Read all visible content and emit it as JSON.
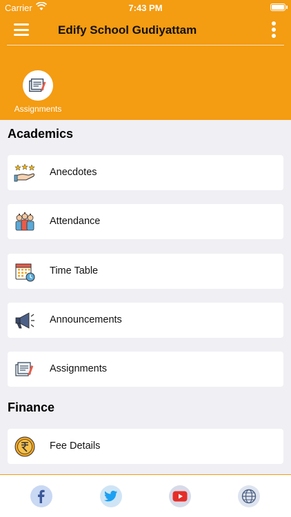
{
  "status_bar": {
    "carrier": "Carrier",
    "time": "7:43 PM"
  },
  "header": {
    "title": "Edify School Gudiyattam"
  },
  "quick_access": {
    "label": "Assignments"
  },
  "sections": {
    "academics": {
      "title": "Academics",
      "items": [
        {
          "label": "Anecdotes",
          "icon": "anecdotes-icon"
        },
        {
          "label": "Attendance",
          "icon": "attendance-icon"
        },
        {
          "label": "Time Table",
          "icon": "time-table-icon"
        },
        {
          "label": "Announcements",
          "icon": "megaphone-icon"
        },
        {
          "label": "Assignments",
          "icon": "assignments-icon"
        }
      ]
    },
    "finance": {
      "title": "Finance",
      "items": [
        {
          "label": "Fee Details",
          "icon": "rupee-coin-icon"
        }
      ]
    }
  },
  "social": [
    "facebook-icon",
    "twitter-icon",
    "youtube-icon",
    "globe-icon"
  ],
  "colors": {
    "accent": "#f49c12",
    "background": "#efeff4"
  }
}
